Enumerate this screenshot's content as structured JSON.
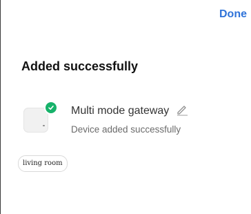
{
  "header": {
    "done_label": "Done"
  },
  "main": {
    "title": "Added successfully",
    "device": {
      "name": "Multi mode gateway",
      "status": "Device added successfully",
      "badge_icon": "check-icon",
      "edit_icon": "pencil-icon",
      "badge_color": "#17b26a"
    },
    "rooms": [
      {
        "label": "living room"
      }
    ]
  },
  "colors": {
    "accent": "#2f73d9",
    "success": "#17b26a"
  }
}
